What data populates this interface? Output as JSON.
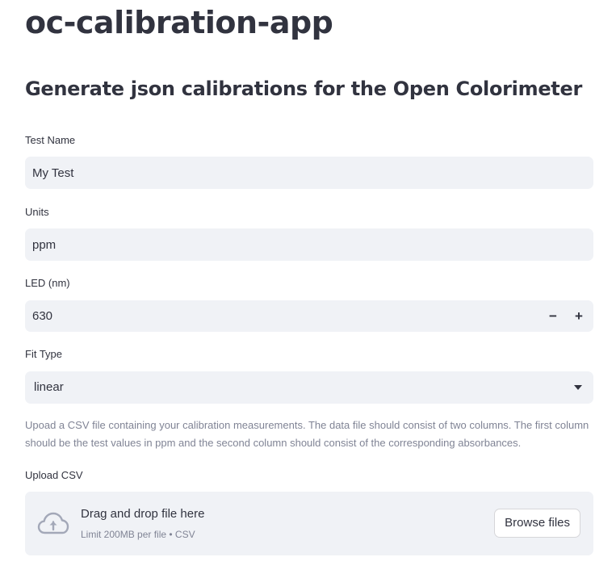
{
  "app": {
    "title": "oc-calibration-app",
    "subtitle": "Generate json calibrations for the Open Colorimeter"
  },
  "form": {
    "test_name": {
      "label": "Test Name",
      "value": "My Test"
    },
    "units": {
      "label": "Units",
      "value": "ppm"
    },
    "led": {
      "label": "LED (nm)",
      "value": "630",
      "decrement": "−",
      "increment": "+"
    },
    "fit_type": {
      "label": "Fit Type",
      "selected": "linear"
    }
  },
  "help_text": "Upoad a CSV file containing your calibration measurements. The data file should consist of two columns. The first column should be the test values in ppm and the second column should consist of the corresponding absorbances.",
  "uploader": {
    "label": "Upload CSV",
    "drop_text": "Drag and drop file here",
    "limit_text": "Limit 200MB per file • CSV",
    "browse_label": "Browse files",
    "icon": "cloud-upload-icon"
  },
  "colors": {
    "text": "#31333f",
    "muted": "#808495",
    "field_bg": "#f0f2f6",
    "icon": "#a3a8b8"
  }
}
